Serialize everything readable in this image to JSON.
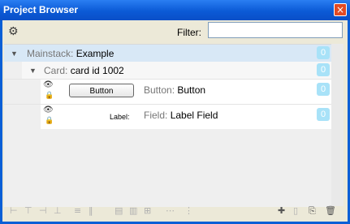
{
  "window": {
    "title": "Project Browser",
    "close_glyph": "×"
  },
  "toolbar": {
    "filter_label": "Filter:",
    "filter_value": "",
    "gear_icon": "gear-icon"
  },
  "tree": {
    "mainstack": {
      "type": "Mainstack:",
      "name": "Example",
      "count": "0"
    },
    "card": {
      "type": "Card:",
      "name": "card id 1002",
      "count": "0"
    },
    "objects": [
      {
        "thumb": "Button",
        "type": "Button:",
        "name": "Button",
        "count": "0"
      },
      {
        "thumb": "Label:",
        "type": "Field:",
        "name": "Label Field",
        "count": "0"
      }
    ]
  },
  "bottom_icons": [
    "align-left-icon",
    "align-top-icon",
    "align-right-icon",
    "align-bottom-icon",
    "distribute-vertical-icon",
    "distribute-horizontal-icon",
    "same-height-icon",
    "same-width-icon",
    "center-icon",
    "more-icon",
    "resize-icon",
    "new-card-icon",
    "copy-icon",
    "paste-icon",
    "delete-icon"
  ]
}
